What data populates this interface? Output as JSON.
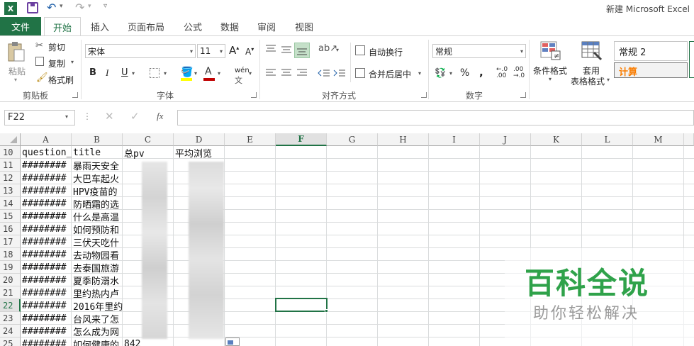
{
  "title_bar": {
    "app_icon_letter": "X",
    "doc_title": "新建 Microsoft Excel",
    "icons": [
      "excel-icon",
      "save-icon",
      "undo-icon",
      "redo-icon",
      "customize-icon"
    ]
  },
  "tabs": [
    "文件",
    "开始",
    "插入",
    "页面布局",
    "公式",
    "数据",
    "审阅",
    "视图"
  ],
  "ribbon": {
    "clipboard": {
      "paste": "粘贴",
      "cut": "剪切",
      "copy": "复制",
      "format_painter": "格式刷",
      "label": "剪贴板"
    },
    "font": {
      "name": "宋体",
      "size": "11",
      "bold": "B",
      "italic": "I",
      "underline": "U",
      "grow": "A",
      "shrink": "A",
      "phonetic": "wén",
      "label": "字体"
    },
    "alignment": {
      "wrap": "自动换行",
      "merge": "合并后居中",
      "label": "对齐方式"
    },
    "number": {
      "format": "常规",
      "percent": "%",
      "comma": ",",
      "label": "数字"
    },
    "styles": {
      "conditional": "条件格式",
      "table_format_1": "套用",
      "table_format_2": "表格格式",
      "style_normal": "常规 2",
      "style_calc": "计算"
    },
    "colors": {
      "accent": "#217346",
      "font_color": "#c00000",
      "highlight": "#ffff00"
    }
  },
  "formula_bar": {
    "name_box": "F22",
    "fx": "fx",
    "value": ""
  },
  "columns": [
    "A",
    "B",
    "C",
    "D",
    "E",
    "F",
    "G",
    "H",
    "I",
    "J",
    "K",
    "L",
    "M"
  ],
  "selected_column": "F",
  "selected_row": "22",
  "rows": [
    {
      "n": "10",
      "a": "question_",
      "b": "title",
      "c": "总pv",
      "d": "平均浏览"
    },
    {
      "n": "11",
      "a": "########",
      "b": "暴雨天安全"
    },
    {
      "n": "12",
      "a": "########",
      "b": "大巴车起火"
    },
    {
      "n": "13",
      "a": "########",
      "b": "HPV疫苗的"
    },
    {
      "n": "14",
      "a": "########",
      "b": "防晒霜的选"
    },
    {
      "n": "15",
      "a": "########",
      "b": "什么是高温"
    },
    {
      "n": "16",
      "a": "########",
      "b": "如何预防和"
    },
    {
      "n": "17",
      "a": "########",
      "b": "三伏天吃什"
    },
    {
      "n": "18",
      "a": "########",
      "b": "去动物园看"
    },
    {
      "n": "19",
      "a": "########",
      "b": "去泰国旅游"
    },
    {
      "n": "20",
      "a": "########",
      "b": "夏季防溺水"
    },
    {
      "n": "21",
      "a": "########",
      "b": "里约热内卢"
    },
    {
      "n": "22",
      "a": "########",
      "b": "2016年里约"
    },
    {
      "n": "23",
      "a": "########",
      "b": "台风来了怎"
    },
    {
      "n": "24",
      "a": "########",
      "b": "怎么成为网"
    },
    {
      "n": "25",
      "a": "########",
      "b": "如何健康的",
      "c": "842"
    }
  ],
  "watermark": {
    "title": "百科全说",
    "subtitle": "助你轻松解决"
  }
}
